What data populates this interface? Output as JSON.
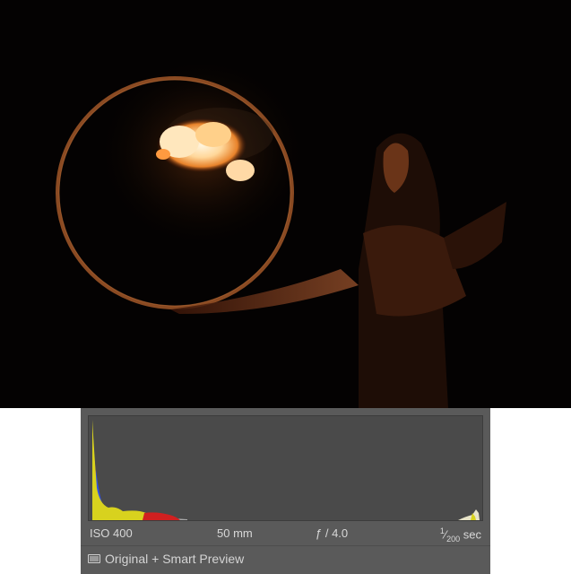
{
  "photo": {
    "description_icon": "image-preview"
  },
  "histogram": {
    "colors": {
      "yellow": "#d8d21e",
      "red": "#d02020",
      "magenta": "#c020c0",
      "blue": "#3050e0",
      "gray": "#a8a8a8",
      "background": "#4a4a4a"
    }
  },
  "exif": {
    "iso": "ISO 400",
    "focal_length": "50 mm",
    "aperture": "ƒ / 4.0",
    "shutter_numerator": "1",
    "shutter_denominator": "200",
    "shutter_unit": "sec"
  },
  "status": {
    "icon": "smart-preview-icon",
    "label": "Original + Smart Preview"
  }
}
